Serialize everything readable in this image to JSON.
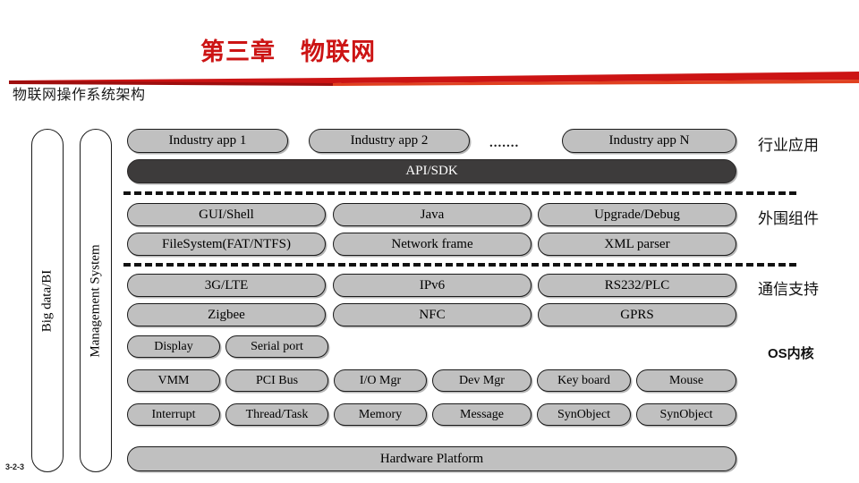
{
  "slide": {
    "title": "第三章　物联网",
    "subtitle": "物联网操作系统架构",
    "page_number": "3-2-3",
    "title_color": "#CC1414",
    "accent_color": "#CC1414"
  },
  "diagram": {
    "side_columns": [
      {
        "label": "Big data/BI"
      },
      {
        "label": "Management System"
      }
    ],
    "apps_row": {
      "items": [
        {
          "label": "Industry app 1"
        },
        {
          "label": "Industry app 2"
        },
        {
          "label": "Industry app N"
        }
      ],
      "ellipsis": "......."
    },
    "api_bar": {
      "label": "API/SDK"
    },
    "middleware_rows": [
      [
        {
          "label": "GUI/Shell"
        },
        {
          "label": "Java"
        },
        {
          "label": "Upgrade/Debug"
        }
      ],
      [
        {
          "label": "FileSystem(FAT/NTFS)"
        },
        {
          "label": "Network frame"
        },
        {
          "label": "XML parser"
        }
      ]
    ],
    "comm_rows": [
      [
        {
          "label": "3G/LTE"
        },
        {
          "label": "IPv6"
        },
        {
          "label": "RS232/PLC"
        }
      ],
      [
        {
          "label": "Zigbee"
        },
        {
          "label": "NFC"
        },
        {
          "label": "GPRS"
        }
      ]
    ],
    "driver_row": [
      {
        "label": "Display"
      },
      {
        "label": "Serial port"
      }
    ],
    "kernel_rows": [
      [
        {
          "label": "VMM"
        },
        {
          "label": "PCI Bus"
        },
        {
          "label": "I/O Mgr"
        },
        {
          "label": "Dev Mgr"
        },
        {
          "label": "Key board"
        },
        {
          "label": "Mouse"
        }
      ],
      [
        {
          "label": "Interrupt"
        },
        {
          "label": "Thread/Task"
        },
        {
          "label": "Memory"
        },
        {
          "label": "Message"
        },
        {
          "label": "SynObject"
        },
        {
          "label": "SynObject"
        }
      ]
    ],
    "hardware_bar": {
      "label": "Hardware Platform"
    },
    "group_labels": [
      {
        "label": "行业应用"
      },
      {
        "label": "外围组件"
      },
      {
        "label": "通信支持"
      },
      {
        "label": "OS内核"
      }
    ]
  }
}
